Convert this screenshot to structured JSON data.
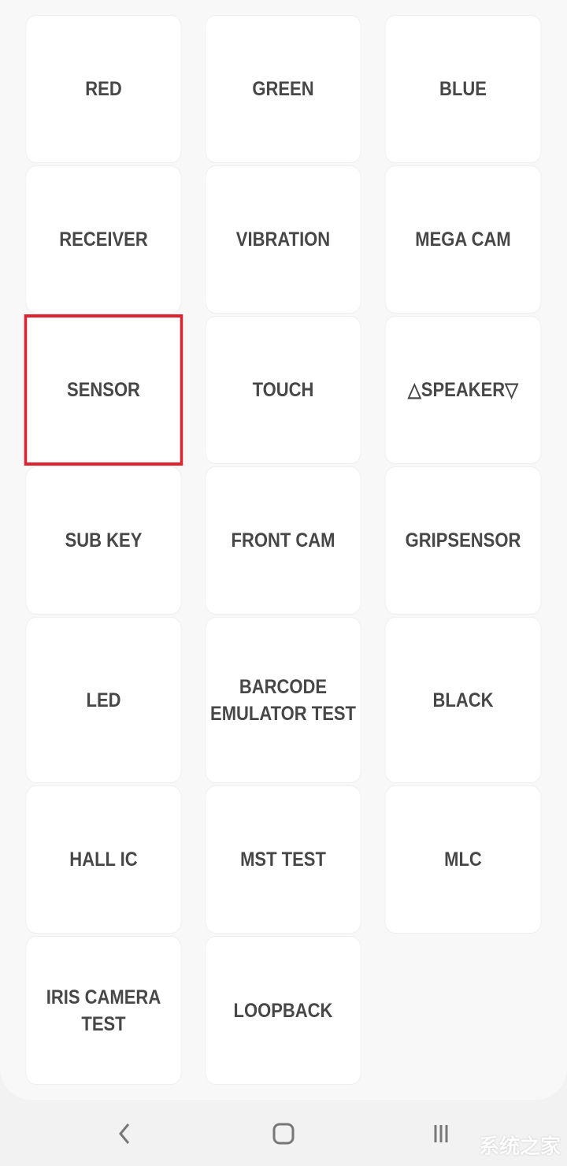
{
  "tiles": [
    {
      "label": "RED"
    },
    {
      "label": "GREEN"
    },
    {
      "label": "BLUE"
    },
    {
      "label": "RECEIVER"
    },
    {
      "label": "VIBRATION"
    },
    {
      "label": "MEGA CAM"
    },
    {
      "label": "SENSOR",
      "selected": true
    },
    {
      "label": "TOUCH"
    },
    {
      "label": "△SPEAKER▽"
    },
    {
      "label": "SUB KEY"
    },
    {
      "label": "FRONT CAM"
    },
    {
      "label": "GRIPSENSOR"
    },
    {
      "label": "LED"
    },
    {
      "label": "BARCODE\nEMULATOR TEST"
    },
    {
      "label": "BLACK"
    },
    {
      "label": "HALL IC"
    },
    {
      "label": "MST TEST"
    },
    {
      "label": "MLC"
    },
    {
      "label": "IRIS CAMERA TEST"
    },
    {
      "label": "LOOPBACK"
    }
  ],
  "selection_color": "#e0222e",
  "nav": {
    "icons": [
      "back-icon",
      "home-icon",
      "recent-apps-icon"
    ]
  },
  "watermark": "系统之家"
}
